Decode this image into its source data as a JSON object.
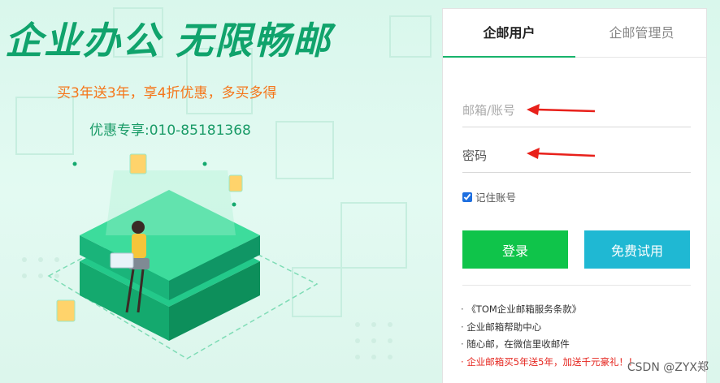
{
  "hero": {
    "slogan": "企业办公 无限畅邮",
    "promo": "买3年送3年，享4折优惠，多买多得",
    "phone": "优惠专享:010-85181368"
  },
  "login": {
    "tabs": [
      {
        "label": "企邮用户",
        "active": true
      },
      {
        "label": "企邮管理员",
        "active": false
      }
    ],
    "email_placeholder": "邮箱/账号",
    "password_placeholder": "密码",
    "remember_label": "记住账号",
    "remember_checked": true,
    "login_button": "登录",
    "trial_button": "免费试用",
    "links": [
      "《TOM企业邮箱服务条款》",
      "企业邮箱帮助中心",
      "随心邮，在微信里收邮件",
      "企业邮箱买5年送5年，加送千元豪礼！！"
    ]
  },
  "watermark": "CSDN @ZYX郑",
  "colors": {
    "brand_green": "#10a36c",
    "promo_orange": "#f5761a",
    "login_green": "#0fc44a",
    "trial_cyan": "#1fb8d3",
    "annotation_red": "#e8201a"
  }
}
